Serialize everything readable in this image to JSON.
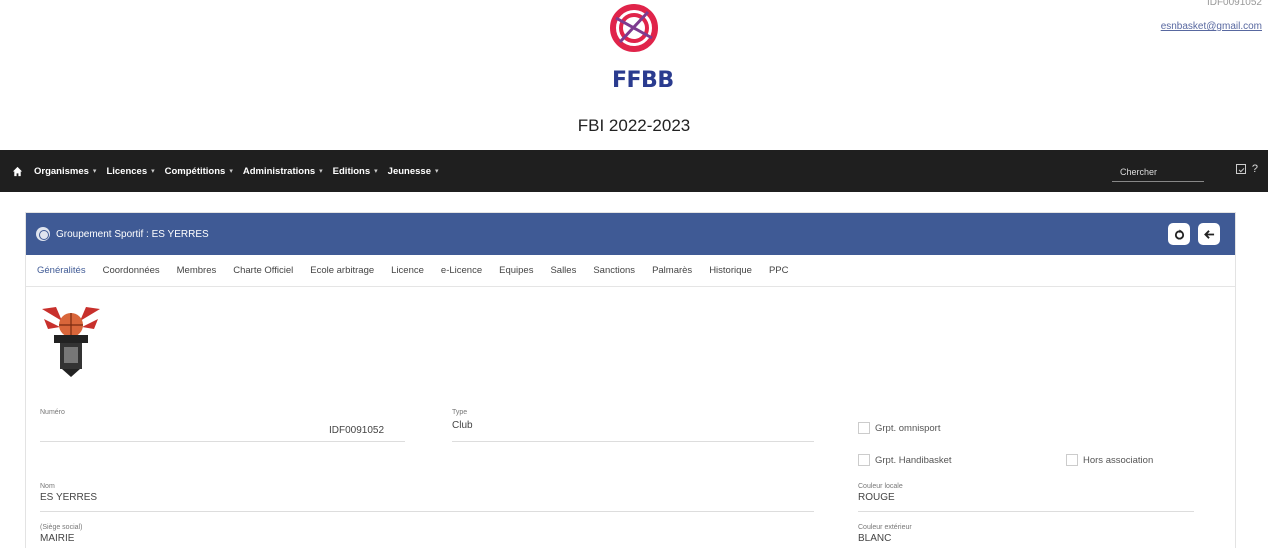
{
  "header": {
    "club_code": "IDF0091052",
    "email": "esnbasket@gmail.com",
    "logo_text": "FFBB",
    "app_title": "FBI 2022-2023"
  },
  "navbar": {
    "items": [
      {
        "label": "Organismes"
      },
      {
        "label": "Licences"
      },
      {
        "label": "Compétitions"
      },
      {
        "label": "Administrations"
      },
      {
        "label": "Editions"
      },
      {
        "label": "Jeunesse"
      }
    ],
    "search_placeholder": "Chercher",
    "help": "?"
  },
  "card": {
    "title": "Groupement Sportif : ES YERRES",
    "tabs": [
      {
        "label": "Généralités"
      },
      {
        "label": "Coordonnées"
      },
      {
        "label": "Membres"
      },
      {
        "label": "Charte Officiel"
      },
      {
        "label": "Ecole arbitrage"
      },
      {
        "label": "Licence"
      },
      {
        "label": "e-Licence"
      },
      {
        "label": "Equipes"
      },
      {
        "label": "Salles"
      },
      {
        "label": "Sanctions"
      },
      {
        "label": "Palmarès"
      },
      {
        "label": "Historique"
      },
      {
        "label": "PPC"
      }
    ],
    "active_tab": "Généralités",
    "accent_color": "#3f5a95"
  },
  "form": {
    "numero": {
      "label": "Numéro",
      "value": "IDF0091052"
    },
    "type": {
      "label": "Type",
      "value": "Club"
    },
    "nom": {
      "label": "Nom",
      "value": "ES YERRES"
    },
    "siege": {
      "label": "(Siège social)",
      "value": "MAIRIE"
    },
    "couleur_locale": {
      "label": "Couleur locale",
      "value": "ROUGE"
    },
    "couleur_exterieur": {
      "label": "Couleur extérieur",
      "value": "BLANC"
    },
    "checkboxes": {
      "omnisport": {
        "label": "Grpt. omnisport",
        "checked": false
      },
      "handibasket": {
        "label": "Grpt. Handibasket",
        "checked": false
      },
      "hors_association": {
        "label": "Hors association",
        "checked": false
      }
    }
  }
}
